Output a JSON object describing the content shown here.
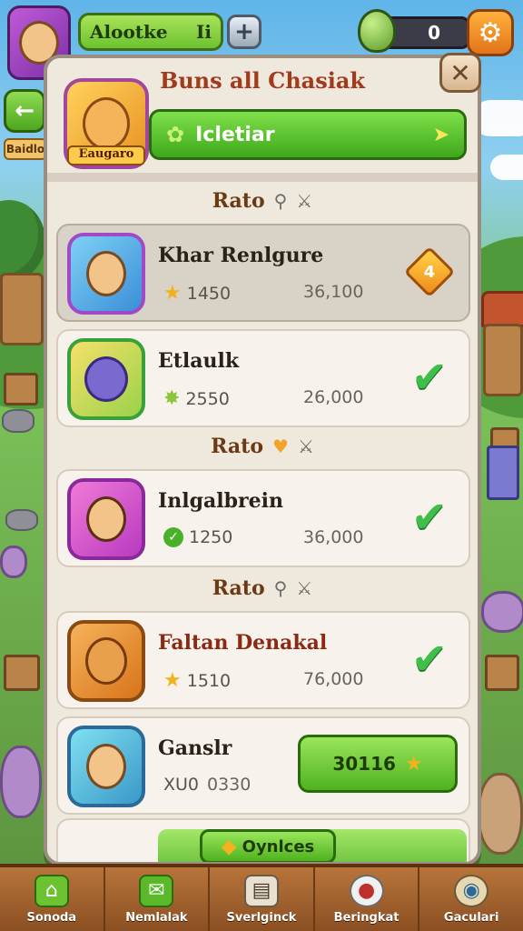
{
  "hud": {
    "player_name": "Alootke",
    "player_level": "Ii",
    "plus_label": "+",
    "counter_value": "0",
    "settings_icon": "gear-icon",
    "back_label": "←",
    "side_label": "Baidlo"
  },
  "panel": {
    "title": "Buns all Chasiak",
    "close_label": "✕",
    "hero": {
      "caption": "Eaugaro",
      "bar_label": "Icletiar"
    }
  },
  "sections": [
    {
      "label": "Rato",
      "icons": [
        "pin-icon",
        "sword-icon"
      ]
    },
    {
      "label": "Rato",
      "icons": [
        "heart-icon",
        "sword-icon"
      ]
    },
    {
      "label": "Rato",
      "icons": [
        "pin-icon",
        "sword-icon"
      ]
    }
  ],
  "entries": [
    {
      "name": "Khar Renlgure",
      "score": "1450",
      "power": "36,100",
      "status": "rank",
      "rank": "4",
      "score_icon": "star"
    },
    {
      "name": "Etlaulk",
      "score": "2550",
      "power": "26,000",
      "status": "done",
      "score_icon": "leaf"
    },
    {
      "name": "Inlgalbrein",
      "score": "1250",
      "power": "36,000",
      "status": "done",
      "score_icon": "check"
    },
    {
      "name": "Faltan Denakal",
      "score": "1510",
      "power": "76,000",
      "status": "done",
      "score_icon": "star"
    },
    {
      "name": "Ganslr",
      "score": "XU0",
      "power": "0330",
      "status": "claim",
      "claim_label": "30116"
    }
  ],
  "bottom_row": {
    "button_label": "Oynlces"
  },
  "nav": [
    {
      "label": "Sonoda",
      "icon": "home-icon"
    },
    {
      "label": "Nemlalak",
      "icon": "mail-icon"
    },
    {
      "label": "Sverlginck",
      "icon": "shop-icon"
    },
    {
      "label": "Beringkat",
      "icon": "social-icon"
    },
    {
      "label": "Gaculari",
      "icon": "globe-icon"
    }
  ]
}
